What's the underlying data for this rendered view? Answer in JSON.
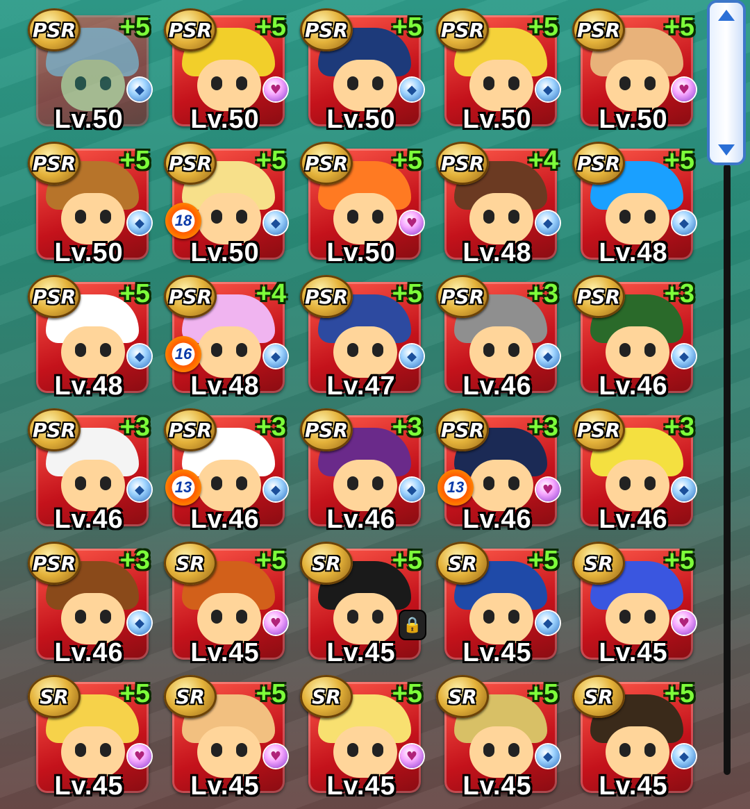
{
  "scrollbar": {
    "position_fraction": 0.0
  },
  "cards": [
    {
      "rank": "PSR",
      "plus": "+5",
      "level": "Lv.50",
      "type": "drop",
      "hair": "#b9a6d6",
      "faded": true
    },
    {
      "rank": "PSR",
      "plus": "+5",
      "level": "Lv.50",
      "type": "heart",
      "hair": "#f2cf2a"
    },
    {
      "rank": "PSR",
      "plus": "+5",
      "level": "Lv.50",
      "type": "drop",
      "hair": "#1d3a7a"
    },
    {
      "rank": "PSR",
      "plus": "+5",
      "level": "Lv.50",
      "type": "drop",
      "hair": "#f5d23a"
    },
    {
      "rank": "PSR",
      "plus": "+5",
      "level": "Lv.50",
      "type": "heart",
      "hair": "#e8b27a"
    },
    {
      "rank": "PSR",
      "plus": "+5",
      "level": "Lv.50",
      "type": "drop",
      "hair": "#b7742a"
    },
    {
      "rank": "PSR",
      "plus": "+5",
      "level": "Lv.50",
      "type": "drop",
      "hair": "#f7e08a",
      "badge": "18"
    },
    {
      "rank": "PSR",
      "plus": "+5",
      "level": "Lv.50",
      "type": "heart",
      "hair": "#ff7a22"
    },
    {
      "rank": "PSR",
      "plus": "+4",
      "level": "Lv.48",
      "type": "drop",
      "hair": "#6b3a22"
    },
    {
      "rank": "PSR",
      "plus": "+5",
      "level": "Lv.48",
      "type": "drop",
      "hair": "#1aa0ff"
    },
    {
      "rank": "PSR",
      "plus": "+5",
      "level": "Lv.48",
      "type": "drop",
      "hair": "#ffffff"
    },
    {
      "rank": "PSR",
      "plus": "+4",
      "level": "Lv.48",
      "type": "drop",
      "hair": "#f0b4f0",
      "badge": "16"
    },
    {
      "rank": "PSR",
      "plus": "+5",
      "level": "Lv.47",
      "type": "drop",
      "hair": "#2d4aa0"
    },
    {
      "rank": "PSR",
      "plus": "+3",
      "level": "Lv.46",
      "type": "drop",
      "hair": "#8f8f8f"
    },
    {
      "rank": "PSR",
      "plus": "+3",
      "level": "Lv.46",
      "type": "drop",
      "hair": "#2a6a2a"
    },
    {
      "rank": "PSR",
      "plus": "+3",
      "level": "Lv.46",
      "type": "drop",
      "hair": "#f4f4f4"
    },
    {
      "rank": "PSR",
      "plus": "+3",
      "level": "Lv.46",
      "type": "drop",
      "hair": "#ffffff",
      "badge": "13"
    },
    {
      "rank": "PSR",
      "plus": "+3",
      "level": "Lv.46",
      "type": "drop",
      "hair": "#6a2a8a"
    },
    {
      "rank": "PSR",
      "plus": "+3",
      "level": "Lv.46",
      "type": "heart",
      "hair": "#1b2a55",
      "badge": "13"
    },
    {
      "rank": "PSR",
      "plus": "+3",
      "level": "Lv.46",
      "type": "drop",
      "hair": "#f4e040"
    },
    {
      "rank": "PSR",
      "plus": "+3",
      "level": "Lv.46",
      "type": "drop",
      "hair": "#8a4a1a"
    },
    {
      "rank": "SR",
      "plus": "+5",
      "level": "Lv.45",
      "type": "heart",
      "hair": "#d2601a"
    },
    {
      "rank": "SR",
      "plus": "+5",
      "level": "Lv.45",
      "type": "lock",
      "hair": "#1a1a1a"
    },
    {
      "rank": "SR",
      "plus": "+5",
      "level": "Lv.45",
      "type": "drop",
      "hair": "#1f4aa8"
    },
    {
      "rank": "SR",
      "plus": "+5",
      "level": "Lv.45",
      "type": "heart",
      "hair": "#3a56e0"
    },
    {
      "rank": "SR",
      "plus": "+5",
      "level": "Lv.45",
      "type": "heart",
      "hair": "#f6d24a"
    },
    {
      "rank": "SR",
      "plus": "+5",
      "level": "Lv.45",
      "type": "heart",
      "hair": "#f2c080"
    },
    {
      "rank": "SR",
      "plus": "+5",
      "level": "Lv.45",
      "type": "heart",
      "hair": "#f8e070"
    },
    {
      "rank": "SR",
      "plus": "+5",
      "level": "Lv.45",
      "type": "drop",
      "hair": "#d8c066"
    },
    {
      "rank": "SR",
      "plus": "+5",
      "level": "Lv.45",
      "type": "drop",
      "hair": "#3a2a1a"
    }
  ]
}
